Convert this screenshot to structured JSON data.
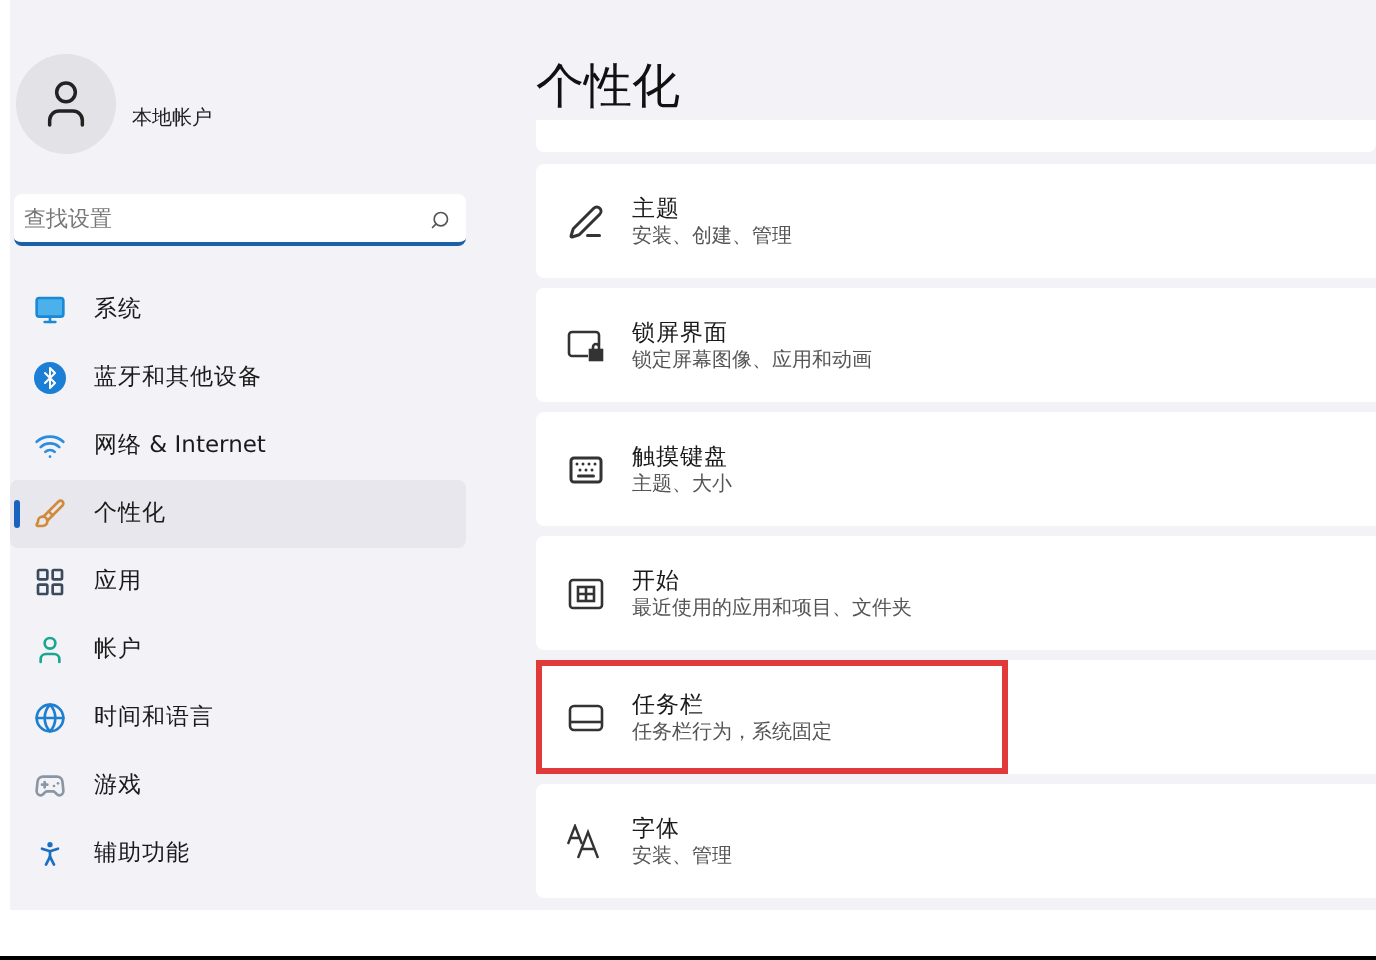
{
  "account": {
    "type": "本地帐户"
  },
  "search": {
    "placeholder": "查找设置"
  },
  "nav": [
    {
      "label": "系统",
      "selected": false
    },
    {
      "label": "蓝牙和其他设备",
      "selected": false
    },
    {
      "label": "网络 & Internet",
      "selected": false
    },
    {
      "label": "个性化",
      "selected": true
    },
    {
      "label": "应用",
      "selected": false
    },
    {
      "label": "帐户",
      "selected": false
    },
    {
      "label": "时间和语言",
      "selected": false
    },
    {
      "label": "游戏",
      "selected": false
    },
    {
      "label": "辅助功能",
      "selected": false
    }
  ],
  "page_title": "个性化",
  "settings": [
    {
      "title": "主题",
      "subtitle": "安装、创建、管理",
      "highlighted": false
    },
    {
      "title": "锁屏界面",
      "subtitle": "锁定屏幕图像、应用和动画",
      "highlighted": false
    },
    {
      "title": "触摸键盘",
      "subtitle": "主题、大小",
      "highlighted": false
    },
    {
      "title": "开始",
      "subtitle": "最近使用的应用和项目、文件夹",
      "highlighted": false
    },
    {
      "title": "任务栏",
      "subtitle": "任务栏行为，系统固定",
      "highlighted": true
    },
    {
      "title": "字体",
      "subtitle": "安装、管理",
      "highlighted": false
    }
  ]
}
